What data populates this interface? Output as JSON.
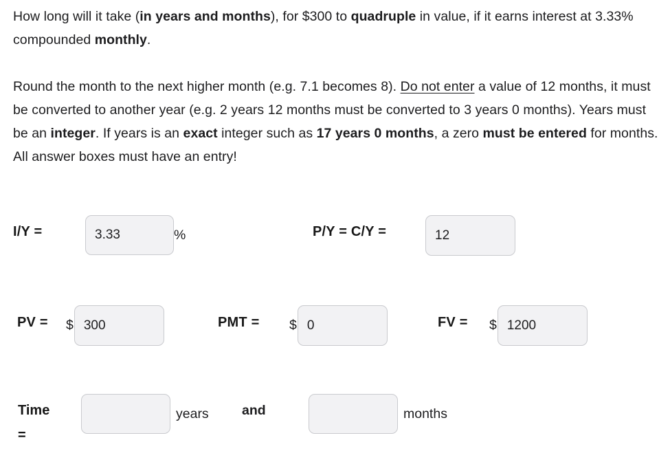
{
  "problem": {
    "paragraph_1": {
      "seg_1": "How long will it take (",
      "seg_2_bold": "in years and months",
      "seg_3": "), for $300 to ",
      "seg_4_bold": "quadruple",
      "seg_5": " in value, if it earns interest at 3.33% compounded ",
      "seg_6_bold": "monthly",
      "seg_7": "."
    },
    "paragraph_2": {
      "seg_1": "Round the month to the next higher month (e.g. 7.1 becomes 8). ",
      "seg_2_underline": "Do not enter",
      "seg_3": " a value of 12 months, it must be converted to another year (e.g. 2 years 12 months must be converted to 3 years 0 months). Years must be an ",
      "seg_4_bold": "integer",
      "seg_5": ". If years is an ",
      "seg_6_bold": "exact",
      "seg_7": " integer such as ",
      "seg_8_bold": "17 years 0 months",
      "seg_9": ", a zero ",
      "seg_10_bold": "must be entered",
      "seg_11": " for months. All answer boxes must have an entry!"
    }
  },
  "fields": {
    "iy": {
      "label": "I/Y =",
      "value": "3.33",
      "suffix": "%"
    },
    "py_cy": {
      "label": "P/Y = C/Y =",
      "value": "12"
    },
    "pv": {
      "label": "PV =",
      "currency": "$",
      "value": "300"
    },
    "pmt": {
      "label": "PMT =",
      "currency": "$",
      "value": "0"
    },
    "fv": {
      "label": "FV =",
      "currency": "$",
      "value": "1200"
    },
    "time": {
      "label": "Time =",
      "years_value": "",
      "years_unit": "years",
      "conjunction": "and",
      "months_value": "",
      "months_unit": "months"
    }
  },
  "colors": {
    "page_background": "#ffffff",
    "text": "#1c1c1e",
    "input_background": "#f2f2f4",
    "input_border": "#c9cace"
  }
}
